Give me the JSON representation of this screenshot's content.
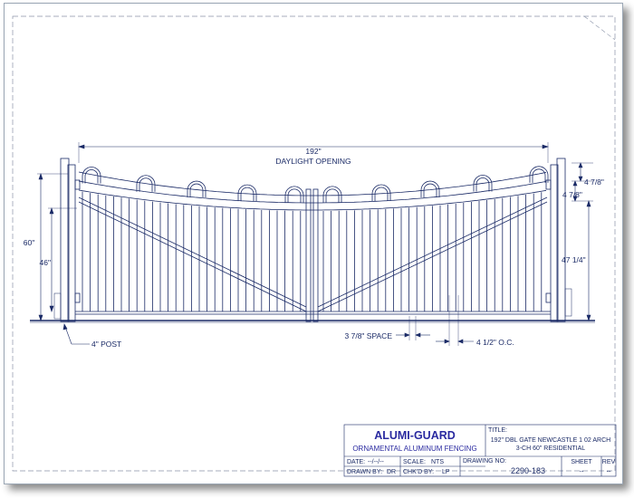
{
  "dimensions": {
    "opening": "192\"",
    "opening_label": "DAYLIGHT OPENING",
    "post_height": "60\"",
    "panel_height": "46\"",
    "top_arch": "4 7/8\"",
    "second_arch": "4 7/8\"",
    "picket_height": "47 1/4\"",
    "post": "4\" POST",
    "space": "3 7/8\" SPACE",
    "on_center": "4 1/2\" O.C."
  },
  "title_block": {
    "brand": "ALUMI-GUARD",
    "brand_sub": "ORNAMENTAL ALUMINUM FENCING",
    "title_label": "TITLE:",
    "title_line1": "192\" DBL GATE NEWCASTLE 1 02 ARCH",
    "title_line2": "3-CH 60\" RESIDENTIAL",
    "date_label": "DATE:",
    "date_value": "--/--/--",
    "scale_label": "SCALE:",
    "scale_value": "NTS",
    "drawn_label": "DRAWN BY:",
    "drawn_value": "DR",
    "checked_label": "CHK'D BY:",
    "checked_value": "LP",
    "drawing_no_label": "DRAWING NO:",
    "drawing_no": "2290-183",
    "sheet_label": "SHEET",
    "sheet_value": "--",
    "rev_label": "REV",
    "rev_value": "--"
  },
  "colors": {
    "line": "#1a2a66",
    "brand": "#2a2aa0"
  }
}
